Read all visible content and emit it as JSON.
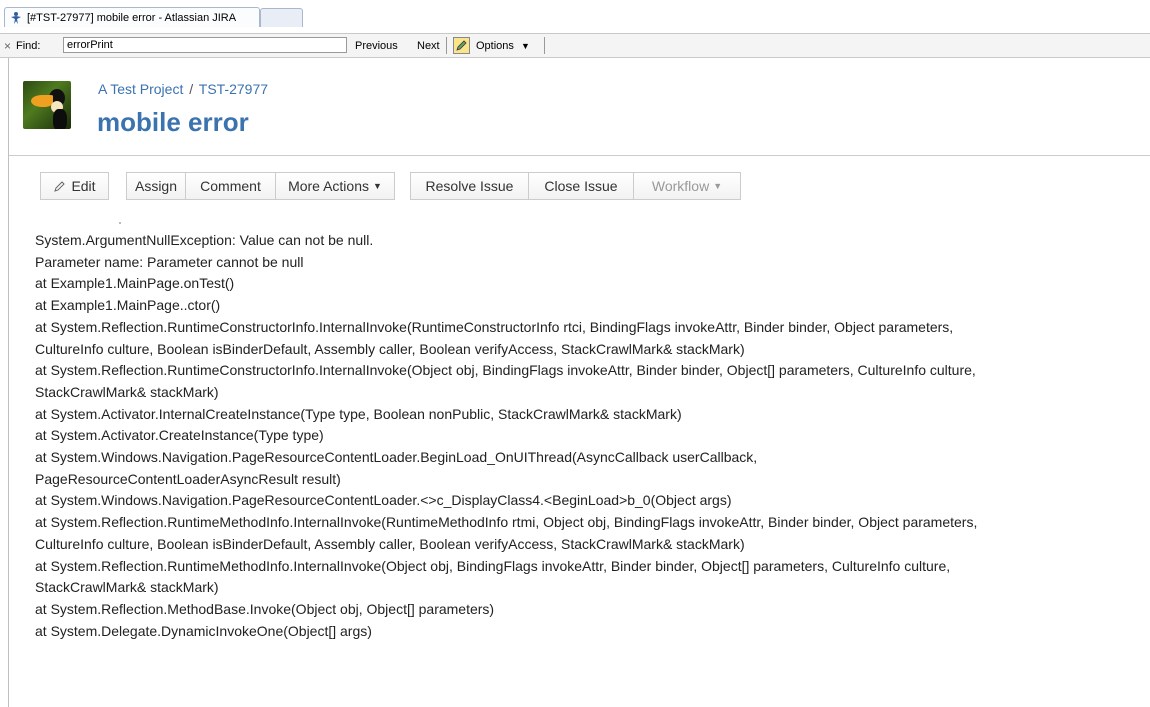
{
  "browser": {
    "tab_title": "[#TST-27977] mobile error - Atlassian JIRA",
    "favicon": "jira-icon"
  },
  "findbar": {
    "close": "×",
    "label": "Find:",
    "query": "errorPrint",
    "previous": "Previous",
    "next": "Next",
    "options": "Options"
  },
  "issue": {
    "project": "A Test Project",
    "separator": "/",
    "key": "TST-27977",
    "title": "mobile error"
  },
  "toolbar": {
    "edit": "Edit",
    "assign": "Assign",
    "comment": "Comment",
    "more_actions": "More Actions",
    "resolve": "Resolve Issue",
    "close": "Close Issue",
    "workflow": "Workflow"
  },
  "description": {
    "lines": [
      "System.ArgumentNullException: Value can not be null.",
      "Parameter name: Parameter cannot be null",
      "at Example1.MainPage.onTest()",
      "at Example1.MainPage..ctor()",
      "at System.Reflection.RuntimeConstructorInfo.InternalInvoke(RuntimeConstructorInfo rtci, BindingFlags invokeAttr, Binder binder, Object parameters,",
      "CultureInfo culture, Boolean isBinderDefault, Assembly caller, Boolean verifyAccess, StackCrawlMark& stackMark)",
      "at System.Reflection.RuntimeConstructorInfo.InternalInvoke(Object obj, BindingFlags invokeAttr, Binder binder, Object[] parameters, CultureInfo culture,",
      "StackCrawlMark& stackMark)",
      "at System.Activator.InternalCreateInstance(Type type, Boolean nonPublic, StackCrawlMark& stackMark)",
      "at System.Activator.CreateInstance(Type type)",
      "at System.Windows.Navigation.PageResourceContentLoader.BeginLoad_OnUIThread(AsyncCallback userCallback,",
      "PageResourceContentLoaderAsyncResult result)",
      "at System.Windows.Navigation.PageResourceContentLoader.<>c_DisplayClass4.<BeginLoad>b_0(Object args)",
      "at System.Reflection.RuntimeMethodInfo.InternalInvoke(RuntimeMethodInfo rtmi, Object obj, BindingFlags invokeAttr, Binder binder, Object parameters,",
      "CultureInfo culture, Boolean isBinderDefault, Assembly caller, Boolean verifyAccess, StackCrawlMark& stackMark)",
      "at System.Reflection.RuntimeMethodInfo.InternalInvoke(Object obj, BindingFlags invokeAttr, Binder binder, Object[] parameters, CultureInfo culture,",
      "StackCrawlMark& stackMark)",
      "at System.Reflection.MethodBase.Invoke(Object obj, Object[] parameters)",
      "at System.Delegate.DynamicInvokeOne(Object[] args)"
    ]
  },
  "colors": {
    "link_blue": "#3b73af",
    "text": "#222222",
    "disabled": "#999999"
  }
}
